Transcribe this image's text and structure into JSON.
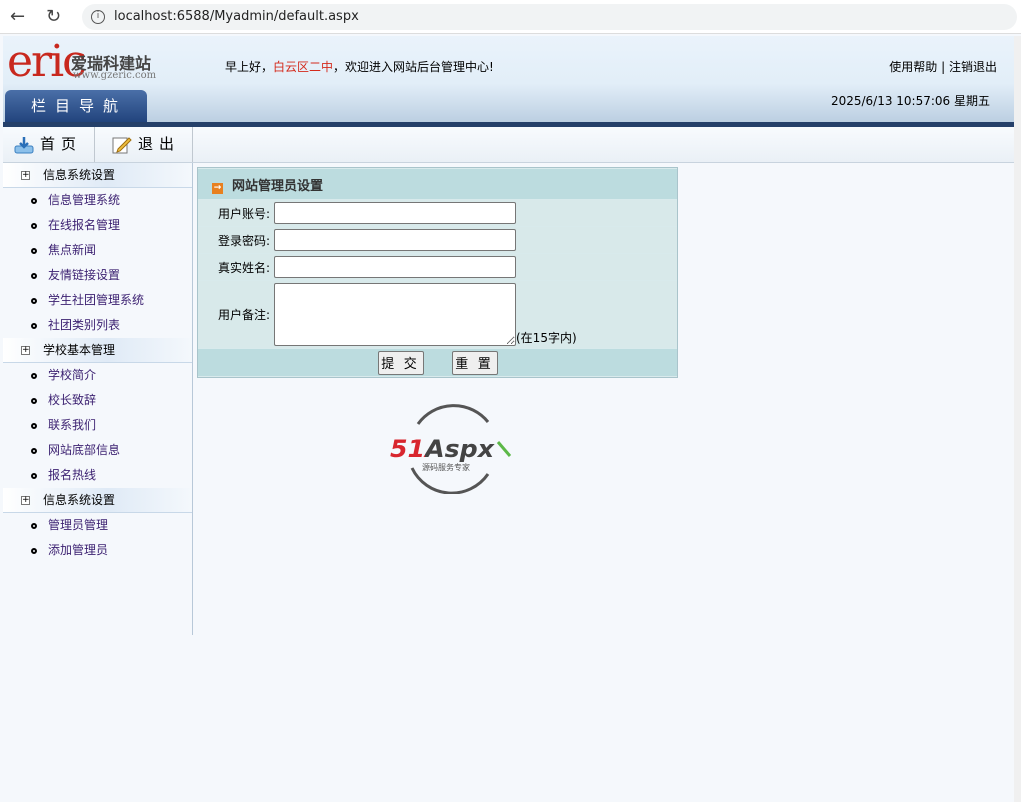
{
  "browser": {
    "url": "localhost:6588/Myadmin/default.aspx"
  },
  "header": {
    "logo": "eric",
    "logo_cn": "爱瑞科建站",
    "logo_url": "www.gzeric.com",
    "nav_tab": "栏目导航",
    "greeting_pre": "早上好，",
    "greeting_name": "白云区二中",
    "greeting_post": "，欢迎进入网站后台管理中心!",
    "help": "使用帮助",
    "sep": " | ",
    "logout": "注销退出",
    "datetime": "2025/6/13 10:57:06 星期五",
    "accent": "#d42a1c"
  },
  "toolbar": {
    "home": "首页",
    "exit": "退出"
  },
  "sidebar": {
    "groups": [
      {
        "title": "信息系统设置",
        "items": [
          "信息管理系统",
          "在线报名管理",
          "焦点新闻",
          "友情链接设置",
          "学生社团管理系统",
          "社团类别列表"
        ]
      },
      {
        "title": "学校基本管理",
        "items": [
          "学校简介",
          "校长致辞",
          "联系我们",
          "网站底部信息",
          "报名热线"
        ]
      },
      {
        "title": "信息系统设置",
        "items": [
          "管理员管理",
          "添加管理员"
        ]
      }
    ]
  },
  "form": {
    "title": "网站管理员设置",
    "account_label": "用户账号:",
    "password_label": "登录密码:",
    "realname_label": "真实姓名:",
    "remark_label": "用户备注:",
    "remark_hint": "(在15字内)",
    "submit": "提 交",
    "reset": "重 置",
    "account": "",
    "password": "",
    "realname": "",
    "remark": ""
  },
  "brand": {
    "name": "51Aspx",
    "tagline": "源码服务专家"
  }
}
